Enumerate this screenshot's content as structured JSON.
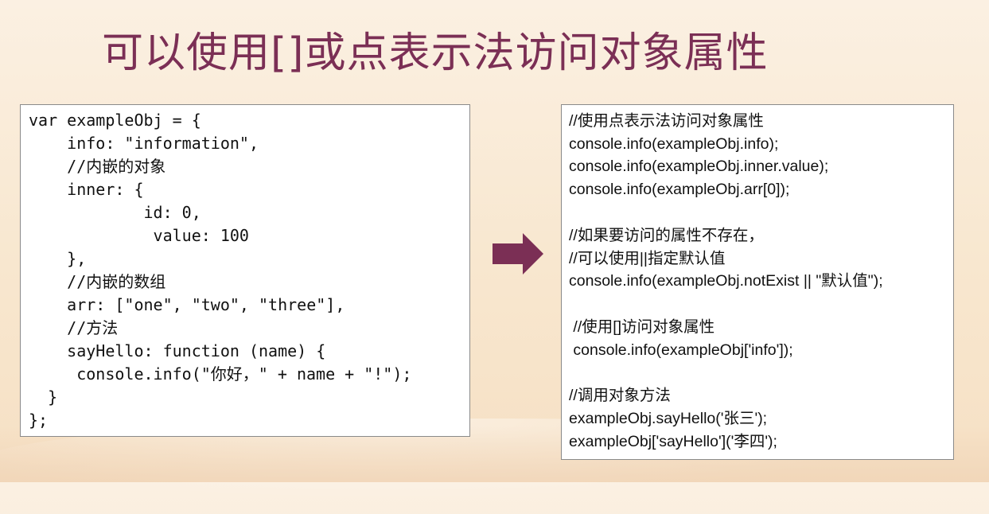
{
  "slide": {
    "title": "可以使用[]或点表示法访问对象属性"
  },
  "left_code": {
    "lines": [
      "var exampleObj = {",
      "    info: \"information\",",
      "    //内嵌的对象",
      "    inner: {",
      "            id: 0,",
      "             value: 100",
      "    },",
      "    //内嵌的数组",
      "    arr: [\"one\", \"two\", \"three\"],",
      "    //方法",
      "    sayHello: function (name) {",
      "     console.info(\"你好，\" + name + \"!\");",
      "  }",
      "};"
    ]
  },
  "right_code": {
    "lines": [
      "//使用点表示法访问对象属性",
      "console.info(exampleObj.info);",
      "console.info(exampleObj.inner.value);",
      "console.info(exampleObj.arr[0]);",
      "",
      "//如果要访问的属性不存在，",
      "//可以使用||指定默认值",
      "console.info(exampleObj.notExist || \"默认值\");",
      "",
      " //使用[]访问对象属性",
      " console.info(exampleObj['info']);",
      "",
      "//调用对象方法",
      "exampleObj.sayHello('张三');",
      "exampleObj['sayHello']('李四');"
    ]
  },
  "icons": {
    "arrow": "right-arrow-icon"
  },
  "colors": {
    "title": "#7b2f55",
    "arrow": "#7b2f55",
    "background": "#f8e7cf"
  }
}
